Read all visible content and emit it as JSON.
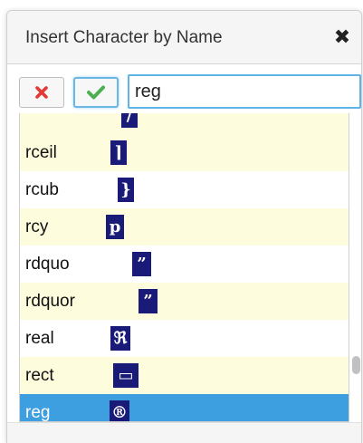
{
  "dialog": {
    "title": "Insert Character by Name",
    "close_symbol": "✖",
    "close_icon": "close-icon",
    "cancel_icon": "red-x-icon",
    "ok_icon": "green-checkmark-icon",
    "accent_color": "#3d9ee0",
    "cancel_color": "#e53935",
    "ok_color": "#4caf50"
  },
  "search": {
    "value": "reg"
  },
  "list": {
    "partial_top_glyph": "/",
    "items": [
      {
        "name": "rceil",
        "glyph": "⌉",
        "selected": false
      },
      {
        "name": "rcub",
        "glyph": "}",
        "selected": false
      },
      {
        "name": "rcy",
        "glyph": "р",
        "selected": false
      },
      {
        "name": "rdquo",
        "glyph": "”",
        "selected": false
      },
      {
        "name": "rdquor",
        "glyph": "”",
        "selected": false
      },
      {
        "name": "real",
        "glyph": "ℜ",
        "selected": false
      },
      {
        "name": "rect",
        "glyph": "▭",
        "selected": false
      },
      {
        "name": "reg",
        "glyph": "®",
        "selected": true
      }
    ]
  }
}
